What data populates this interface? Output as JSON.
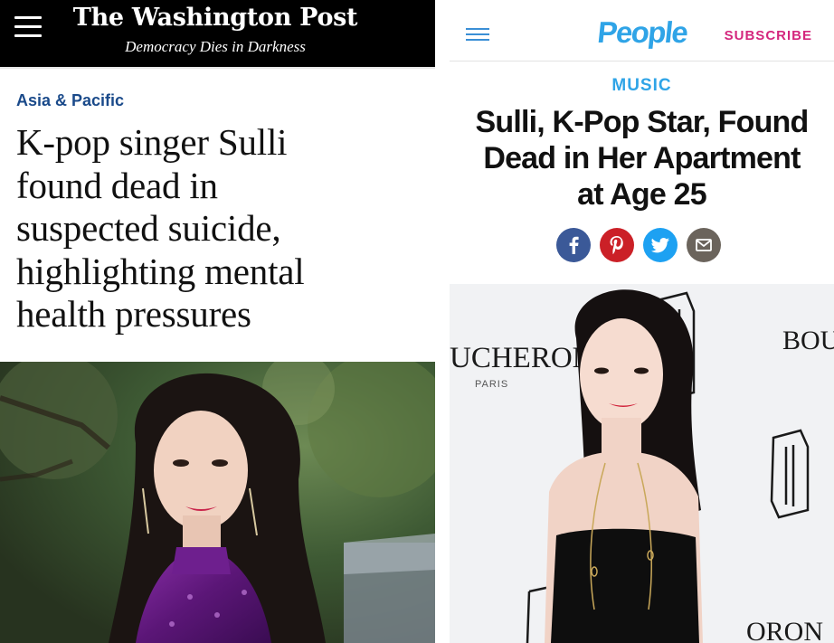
{
  "wapo": {
    "logo": "The Washington Post",
    "tagline": "Democracy Dies in Darkness",
    "section": "Asia & Pacific",
    "headline_lines": [
      "K-pop singer Sulli",
      "found dead in",
      "suspected suicide,",
      "highlighting mental",
      "health pressures"
    ],
    "colors": {
      "header_bg": "#000000",
      "section": "#1a4a8a"
    }
  },
  "people": {
    "logo": "People",
    "subscribe": "SUBSCRIBE",
    "section": "MUSIC",
    "headline_lines": [
      "Sulli, K-Pop Star, Found",
      "Dead in Her Apartment",
      "at Age 25"
    ],
    "share_icons": [
      "facebook-icon",
      "pinterest-icon",
      "twitter-icon",
      "email-icon"
    ],
    "photo_text": {
      "brand_left": "UCHERON",
      "city": "PARIS",
      "brand_right": "BOU",
      "bottom_fragment": "ORON"
    },
    "colors": {
      "brand": "#2fa4e7",
      "subscribe": "#d4267d",
      "facebook": "#3b5998",
      "pinterest": "#cb2027",
      "twitter": "#1da1f2",
      "email": "#6b645c"
    }
  }
}
